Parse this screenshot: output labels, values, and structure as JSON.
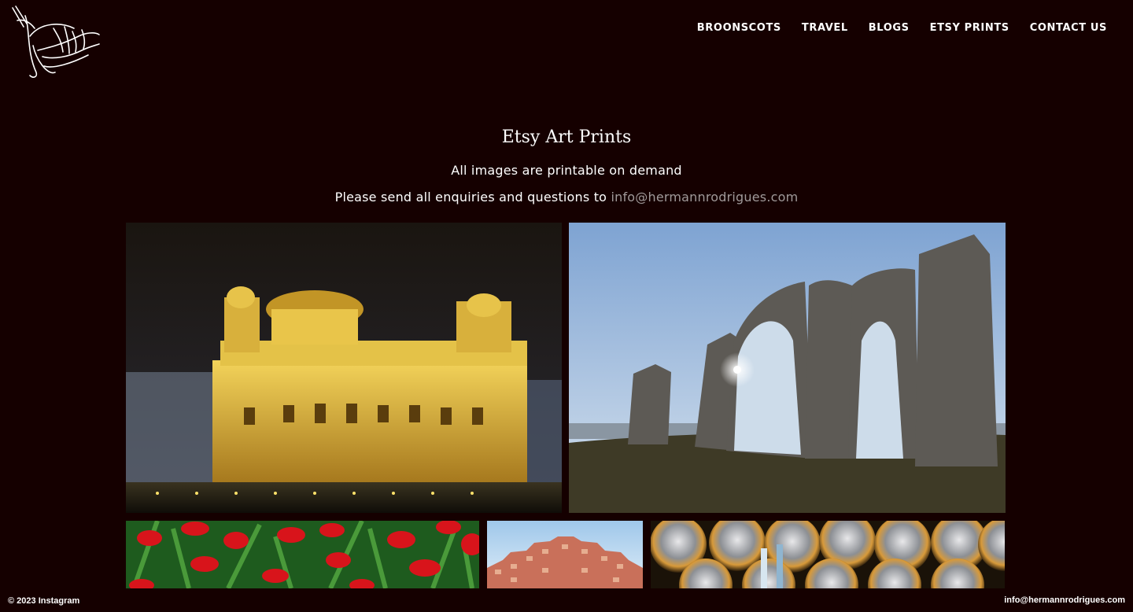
{
  "brand": {
    "logo_name": "Hermann Rodrigues"
  },
  "nav": {
    "items": [
      {
        "label": "BROONSCOTS"
      },
      {
        "label": "TRAVEL"
      },
      {
        "label": "BLOGS"
      },
      {
        "label": "ETSY PRINTS"
      },
      {
        "label": "CONTACT US"
      }
    ]
  },
  "header": {
    "title": "Etsy Art Prints",
    "subtitle": "All images are printable on demand",
    "enquiry_text": "Please send all enquiries and questions to",
    "enquiry_email": "info@hermannrodrigues.com"
  },
  "gallery": {
    "images": [
      {
        "name": "golden-temple-photo"
      },
      {
        "name": "stone-arches-photo"
      },
      {
        "name": "red-tulips-photo"
      },
      {
        "name": "hawa-mahal-photo"
      },
      {
        "name": "metal-spheres-photo"
      }
    ]
  },
  "footer": {
    "copyright": "© 2023",
    "instagram": "Instagram",
    "email": "info@hermannrodrigues.com"
  },
  "colors": {
    "background": "#150000",
    "link_muted": "#a09a9a",
    "text": "#ffffff"
  }
}
